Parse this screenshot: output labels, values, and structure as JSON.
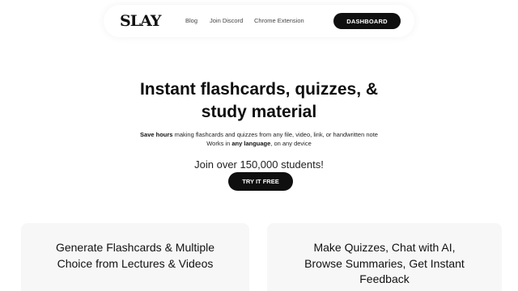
{
  "nav": {
    "logo": "SLAY",
    "links": [
      "Blog",
      "Join Discord",
      "Chrome Extension"
    ],
    "dashboard_label": "DASHBOARD"
  },
  "hero": {
    "headline_line1": "Instant flashcards, quizzes, &",
    "headline_line2": "study material",
    "sub1_bold": "Save hours",
    "sub1_rest": " making flashcards and quizzes from any file, video, link, or handwritten note",
    "sub2_pre": "Works in ",
    "sub2_bold": "any language",
    "sub2_post": ", on any device",
    "join_text": "Join over 150,000 students!",
    "cta_label": "TRY IT FREE"
  },
  "features": [
    {
      "line1": "Generate Flashcards & Multiple",
      "line2": "Choice from Lectures & Videos"
    },
    {
      "line1": "Make Quizzes, Chat with AI,",
      "line2": "Browse Summaries, Get Instant",
      "line3": "Feedback"
    }
  ],
  "colors": {
    "button_bg": "#0f0f0f",
    "card_bg": "#f7f7f7",
    "page_bg": "#ffffff"
  }
}
